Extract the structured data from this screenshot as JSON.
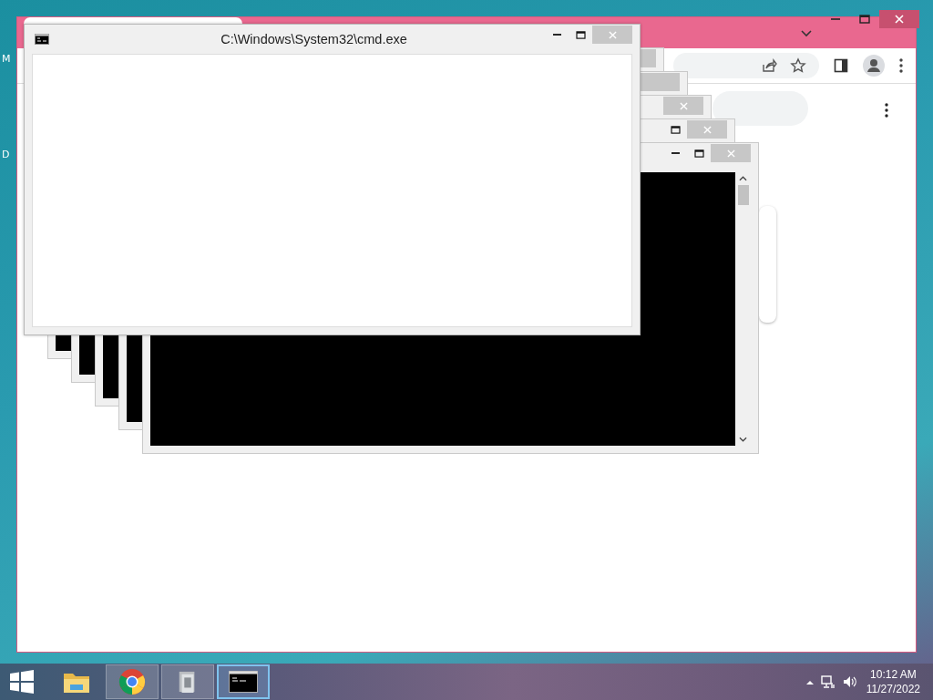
{
  "desktop": {
    "icon_labels": [
      "M",
      "D"
    ]
  },
  "console_windows": [
    {
      "kind": "blank",
      "title": "C:\\Windows\\System32\\cmd.exe"
    },
    {
      "kind": "console"
    },
    {
      "kind": "console"
    },
    {
      "kind": "console"
    },
    {
      "kind": "console"
    },
    {
      "kind": "console"
    }
  ],
  "taskbar": {
    "apps": [
      {
        "kind": "explorer",
        "open": false,
        "selected": false
      },
      {
        "kind": "chrome",
        "open": true,
        "selected": false
      },
      {
        "kind": "app",
        "open": true,
        "selected": false
      },
      {
        "kind": "console",
        "open": true,
        "selected": true
      }
    ],
    "time": "10:12 AM",
    "date": "11/27/2022"
  }
}
